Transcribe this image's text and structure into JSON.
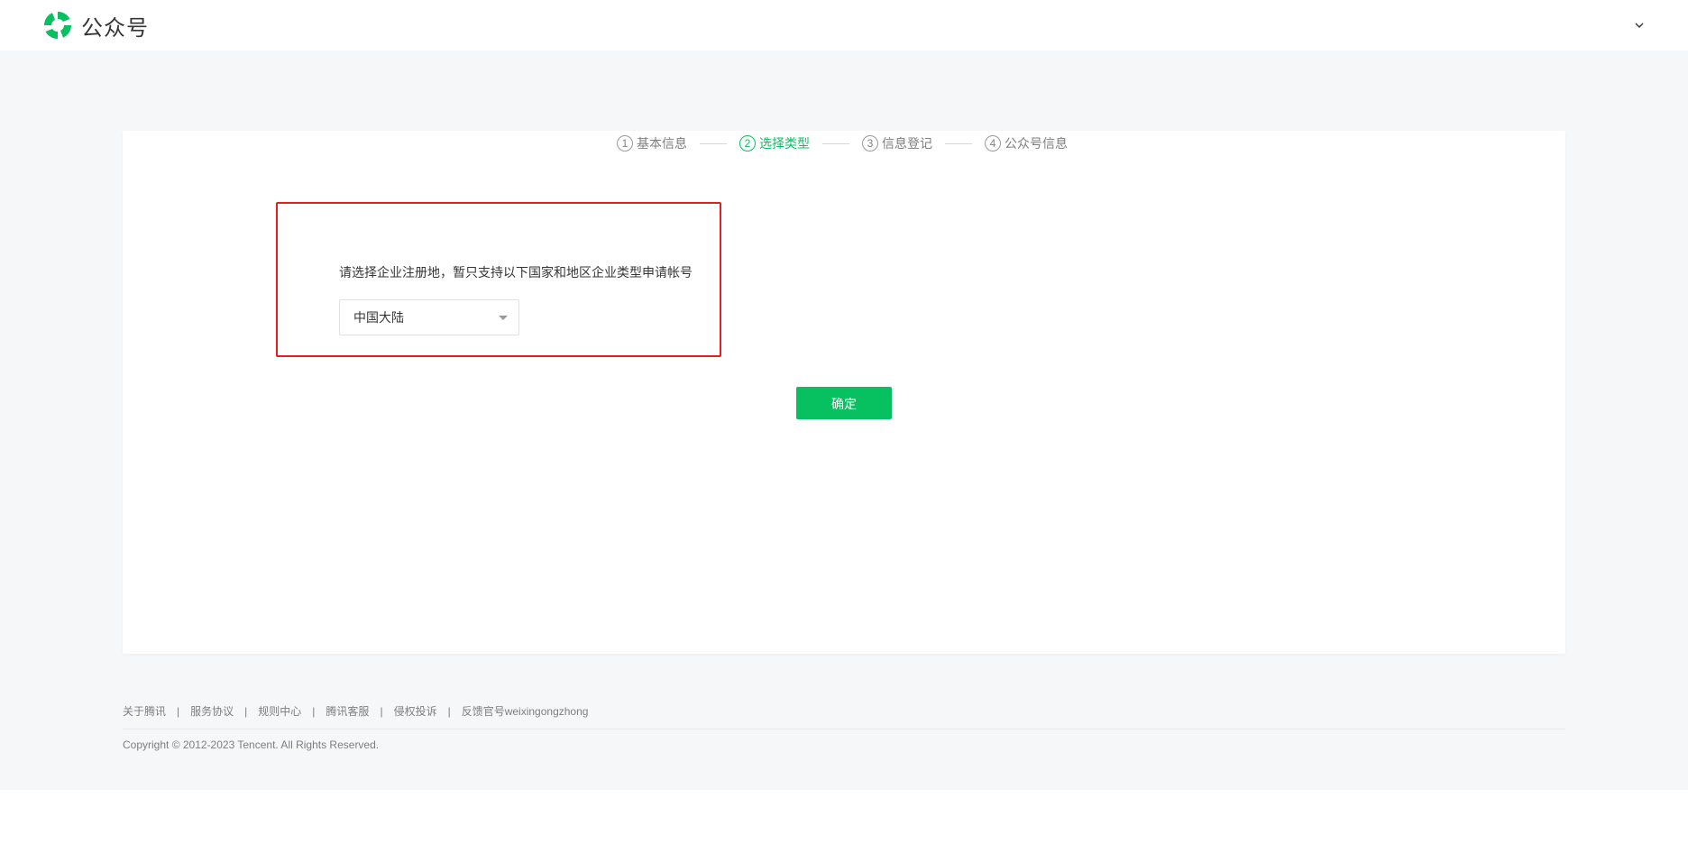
{
  "header": {
    "logo_text": "公众号",
    "logo_icon": "wechat-official-account-logo",
    "menu_icon": "chevron-down-icon",
    "brand_color": "#07c160"
  },
  "steps": [
    {
      "number": "1",
      "label": "基本信息",
      "active": false
    },
    {
      "number": "2",
      "label": "选择类型",
      "active": true
    },
    {
      "number": "3",
      "label": "信息登记",
      "active": false
    },
    {
      "number": "4",
      "label": "公众号信息",
      "active": false
    }
  ],
  "region": {
    "label": "请选择企业注册地，暂只支持以下国家和地区企业类型申请帐号",
    "selected": "中国大陆"
  },
  "confirm_label": "确定",
  "footer": {
    "links": [
      "关于腾讯",
      "服务协议",
      "规则中心",
      "腾讯客服",
      "侵权投诉",
      "反馈官号weixingongzhong"
    ],
    "separator": "|",
    "copyright": "Copyright © 2012-2023 Tencent. All Rights Reserved."
  },
  "colors": {
    "accent": "#07c160",
    "highlight_border": "#e02020",
    "page_background": "#f6f7f9"
  }
}
